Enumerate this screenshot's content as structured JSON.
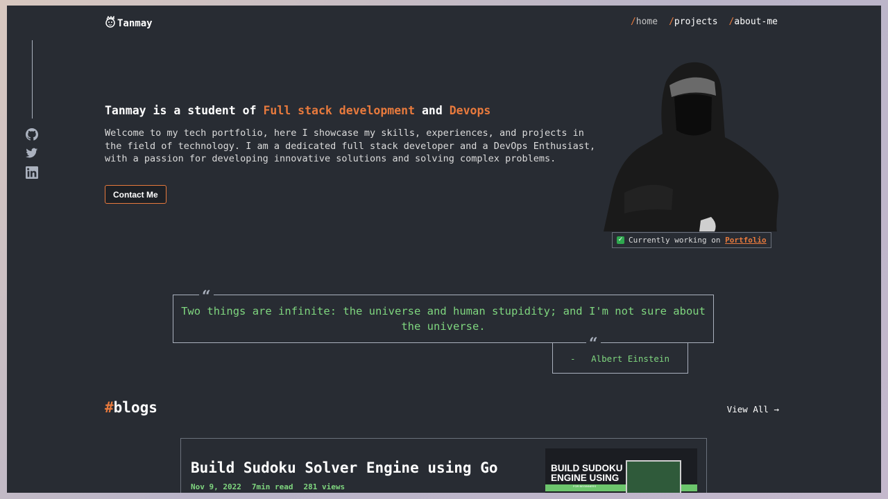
{
  "header": {
    "logo_text": "Tanmay",
    "nav": [
      {
        "slash": "/",
        "label": "home"
      },
      {
        "slash": "/",
        "label": "projects"
      },
      {
        "slash": "/",
        "label": "about-me"
      }
    ]
  },
  "social": [
    "github-icon",
    "twitter-icon",
    "linkedin-icon"
  ],
  "hero": {
    "title_pre": "Tanmay is a student of ",
    "title_accent1": "Full stack development",
    "title_mid": " and ",
    "title_accent2": "Devops",
    "description": "Welcome to my tech portfolio, here I showcase my skills, experiences, and projects in the field of technology. I am a dedicated full stack developer and a DevOps Enthusiast, with a passion for developing innovative solutions and solving complex problems.",
    "contact_label": "Contact Me",
    "status_icon": "✓",
    "status_text": "Currently working on ",
    "status_link": "Portfolio"
  },
  "quote": {
    "mark": "“",
    "text": "Two things are infinite: the universe and human stupidity; and I'm not sure about the universe.",
    "author": "-   Albert Einstein"
  },
  "blogs": {
    "hash": "#",
    "title": "blogs",
    "view_all": "View All →",
    "items": [
      {
        "title": "Build Sudoku Solver Engine using Go",
        "date": "Nov 9, 2022",
        "read_time": "7min read",
        "views": "281 views",
        "thumb_line1": "BUILD SUDOKU",
        "thumb_line2": "ENGINE USING",
        "thumb_sub": "FOR BEGINNERS"
      }
    ]
  },
  "colors": {
    "background": "#282c33",
    "accent": "#e87a3d",
    "quote_green": "#7fd67f"
  }
}
